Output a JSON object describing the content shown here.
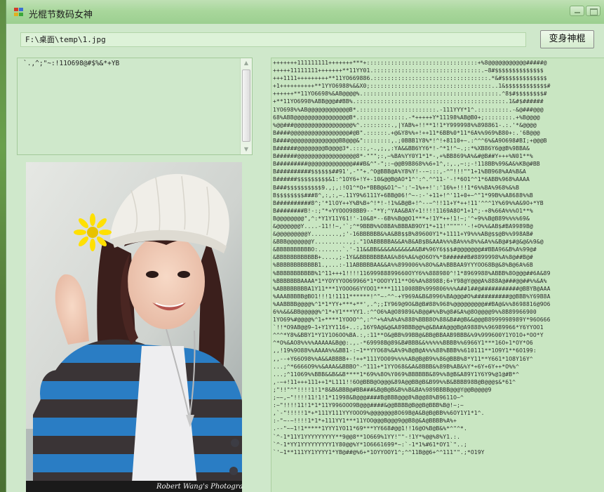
{
  "window": {
    "title": "光棍节数码女神",
    "icon": "app-window-icon"
  },
  "toolbar": {
    "path_value": "F:\\桌面\\temp\\1.jpg",
    "convert_button_label": "变身神棍"
  },
  "char_ramp": "`.,^;\"~:!11O698@#$%&*+YB",
  "photo": {
    "watermark": "Robert Wang's Photography"
  },
  "ascii_art": [
    "+++++++111111111+++++++***+::::::::::::::::::::::::::::::::+%8@@@@@@@@@@@#####@",
    "+++++11111111+++++++**11YY01.:::::::::::::::::::::::::::::::.~8#$$$$$$$$$$$$$$",
    "+++1111+++++++++**11YO669886.:::::::::::::::::::::::::::::::::.*&#$$$$$$$$$$$$$",
    "+1++++++++++**1YYO6988%&&X0;:::::::::::::::::::::::::::::::::::..1&$$$$$$$$$$$$#",
    "++++++**11YO6698%&AB@@@@%.:::::::::::::::::::::::::::::::::::::::.^8$#$$$$$$$$#",
    "+**11YO6998%ABB@@@##BB%.:::::::::::::::::::::::::::::::::::::::::::.1&#$######",
    "1YO698%%AB@@@@@@@@@@@@B*.::::::::::::::::::::::.-111YYY*1^.:::::::::.-&@###@@@",
    "68%ABB@@@@@@@@@@@@@@@@B*.:::::::::::::.-*+++++Y*11198%AB@B0+;::::::::.+%B@@@@",
    "%@@###@@@@@@@@@@@@@@@@@%^.::::::::.,|YAB%+!!**1!1*Y999998%%898861-.:.'*&@@@@",
    "B####@@@@@@@@@@@@@@@@@#@B\".::::::.+@&Y8%%+!++11*6BB%0*11*6A%%969%B80+:.'6B@@@",
    "B####@@@@@@@@@@@@@@BB@@@&\"::::::::,.;0BBB1Y8%*!^!+8110+~.:^^^6%&A9O698#BI;+@@@B",
    "B######@@@@@@@@B@@@@3*.::::,-.,;,,:YA&&BB6YY6*!-^*1!^~.;:*%XB86Y6@@B%9BBA&",
    "B######@@@@@@@@@@@@@@@@@8*-\"\"\";:,~%BA%YY0Y1*1*-,+%BB869%A%&#@B##Y+++%N01**%",
    "B#########@@@@@@@@@@@@@###B&^\"-\";:~@@B9B868%%6+1^,:,.,~:;-!118BB%99&A&%KB@#BB",
    "B##########$$$$$$##91',-\"\"+.^O@BBB@A%Y8%Y!--~:::,-^\"!!!\"\"1+1%BB968%AA%B&A",
    "B######$$$$$$$$$&1:^1OY6+!Y+-10&@@B@AO*1^':^.^^11-'-!*6O1^^1*6ABB%968%AAAA",
    "B###$$$$$$$$$$9.,;,:!O1^*O+*BBB@&O1^~':'~1%++!':'16%+!!!1*6%%BA%968%&%B",
    "B$$$$$$$$###8^,:,:,~.11Y9%6111Y+6BB@06!^~-:-'+11+!^'11+0+~^\"1*99B%%A8688%%B",
    "B##########8^;'*1lOY++Y%B%B+^!*!-!1%&B@B+!^--~^!!11+Y*++!11'^^^1Y%69%%A&9O+*YB",
    "B########B!-:;\"*+YYOOO98BB9--\"*Y;^YAA&BAY+1!!!!1169A8O*1+1^;-+8%66A%%%O1**%",
    "B@@@@@@@@\",^:*Y1Y11Y61!'-10&8*--6B%%B@@O1***+!1Y*++!1!~;'^+9%%B@B89%%%%69&",
    "&@@@@@@@Y....-11!!~,'`;^*9BBB%%O8BA%BBBAB9OY1*+11!\"\"\"\"''-!+O%%&AB$#BA9989B@",
    "&@@@@@@@@@Y........,;'-16BBBBBB&%A&BB$$B%89600Y1*+1111+Y9%%%AB@$$@B%%998AB#",
    "&BBB@@@@@@@Y..........,;.\"1OABBBBBA&&A%B&AB$B&AAA%%%BA%%%8%%&A%%&B@#$#@&@&%9&@",
    "&BBBBBBBBBBO:.......`.'-11&&BB&&&&A&&&&&A&B#%96Y6$$$#@@@@@@@##BBA96&B%A%99@#",
    "&BBBBBBBBBBBB+....,;-1Y&&BBBBBBBAA&%86%A&%@O6OY%*8######B#8899998%A%8@##B@#",
    "%BBBBBBBBBBBB1.,...:-11ABBBBBAA&&A%%899006%%8O%&A%BBBAA9YYYOO68B@&8%B@6A%6B",
    "%BBBBBBBBBBB%1^11+++1!!!!11699988899660OYY6%%888980^!1*8969988%ABBB%8O@@@##6A&89",
    "%BBBBBBBAAAA*1*YOYYYOO69966*1*OOOYY11**O6%A%88988;6+Y98@Y@@@A%888A@###@@##%%&A%",
    "%ABBBBBBBBA1Y11***1YOOO66YYOO1****1111008BB%999806%%%A##1##@###########@BBYB@AAA",
    "%AAABBBBB@BO1!!!1!1111******!^\"~-^^-+Y969A&B&8996%BA@@@#O%##########@@BBB%Y69B8A",
    "%AABBBB@@@@%^1*1*YY+***+**',.^;;IY969@9O&B@B#88%968%@@@@@@@@@##BA@&%%8698816@9O6",
    "6%%&&&BB@@@@@%^1*+Y1***YY1.:^^O6%A@O8989&%B@@#%%B%@8#&A%@8O@@@@9%%8B89966900",
    "1YO69%#@@@@%^1+****1YOOO^^,:^^+%A%A%A%888%BBB8O%88&B##@B&&@@@B8999998989Y*96O666",
    "`!!*O9AB@@9~1+Y1YY116+..:,16Y9A@&@&A89BBB@@%@&BA#A@@@B@A9888%%96989966*Y6YYOO1",
    "^^^*Y8%&BBY1*Y1Y1O6OO%BA.:,:11**O&@BB%99BB@&BB@BBAAB9BBB&%9%999600Y1YO1O+*OO*Y",
    "^*O%&AO8%%%%AAAAA&B@@:.,.-*69998B@89&B#BBB&&%%%%%BBBB%%6966Y1***16O+1*OY*O6",
    ",,!19%9O88%%AAAA%%&BB1-:~1**YYO68%&A%9%B@B@A%%%88%BBB%%610111**1O9Y1**6O199:",
    ",,--+Y66O98%%A&&ABBBB+-!++*111YOO09%%%%AB@B@B9%%86@BBB%8*Y11**Y661*1O8Y16Y^",
    "...;^*6666O9%%&AAA&&BBBO^-^111+*1YYO68&&A&8BBB&%89B%AB&%Y*+6Y+6Y++*O%%^",
    "...;^11069%%BBB&&B&&B****1*69%%8O%Y069%BBBBBB&89%%8@B&A89Y1Y6Y9%@1@#B*^",
    ",-~+!11+++111++1*L111!!6O@BBB@O@@@&89A@@BB@B&B99%%B&BBBB98B@B@@@$&*61^",
    ";\"!!\"^\"!!!!1!1*8&B&BBB@#BB###&B@B@B&B%%B&BA%989BBBB@@@Y@@B@@@@9",
    ";~~,~\"!!!!11!1!1*11998&B@@@####B@BBB@@@8%B@@88%B9611O~^",
    ":~\"!!!!11!1*1*11Y996OOO9B@@@####&@@BBBB@B@@B@BBB%B@!~;~",
    ",`-\"!!!!!1*+*111Y111YYYOOO9%@@@@@@@8O69B@A&B@B@BB%%6OY1Y1*1^.",
    ":-\"~-~!!!!1*1*+111YY1***11YOO@@@B@@@9@@B8@&A@BBBB%A%+",
    ".--\"~~1!1*****1YYY1YO11*69***YY668#@@1!!16@O%B@B&%*^\"^*.",
    "`^-1*11Y1YYYYYYYYY**9@@8**1O669%1YY!\"\"-!1Y*%@@%8%Y1.:.",
    "`^-1*YY1YYYYYYYYY1Y80@@%Y*1O6661699*~:`-1*1%#61*OY1`\"..;",
    "`'~1**111YY1YYYY1*YB@##@%6+*1OYYOOY1^;^^11B@@6+^^111\"\".;*O19Y"
  ]
}
